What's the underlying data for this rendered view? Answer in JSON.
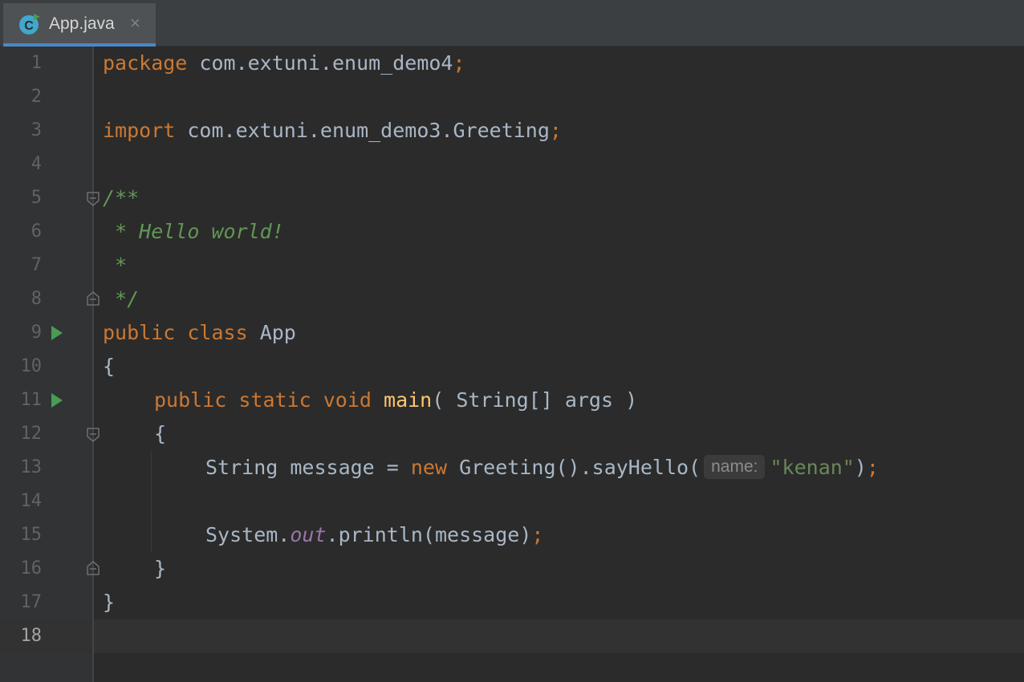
{
  "tab": {
    "label": "App.java",
    "close_glyph": "×",
    "icon": "java-class-icon"
  },
  "colors": {
    "background": "#2b2b2b",
    "keyword": "#cc7832",
    "comment": "#629755",
    "string": "#6a8759",
    "method": "#ffc66d",
    "field": "#9876aa"
  },
  "editor": {
    "current_line": 18,
    "line_numbers": [
      "1",
      "2",
      "3",
      "4",
      "5",
      "6",
      "7",
      "8",
      "9",
      "10",
      "11",
      "12",
      "13",
      "14",
      "15",
      "16",
      "17",
      "18"
    ],
    "lines": {
      "l1": {
        "kw": "package",
        "rest": " com.extuni.enum_demo4",
        "semi": ";"
      },
      "l3": {
        "kw": "import",
        "rest": " com.extuni.enum_demo3.Greeting",
        "semi": ";"
      },
      "l5": {
        "text": "/**"
      },
      "l6": {
        "text": " * Hello world!"
      },
      "l7": {
        "text": " *"
      },
      "l8": {
        "text": " */"
      },
      "l9": {
        "kw1": "public",
        "kw2": "class",
        "name": "App"
      },
      "l10": {
        "text": "{"
      },
      "l11": {
        "kw1": "public",
        "kw2": "static",
        "kw3": "void",
        "method": "main",
        "rest": "( String[] args )"
      },
      "l12": {
        "text": "{"
      },
      "l13": {
        "pre": "String message = ",
        "kw": "new",
        "mid": " Greeting().sayHello(",
        "hint": "name:",
        "str": "\"kenan\"",
        "post": ")",
        "semi": ";"
      },
      "l15": {
        "pre": "System.",
        "field": "out",
        "mid": ".println(message)",
        "semi": ";"
      },
      "l16": {
        "text": "}"
      },
      "l17": {
        "text": "}"
      }
    }
  }
}
